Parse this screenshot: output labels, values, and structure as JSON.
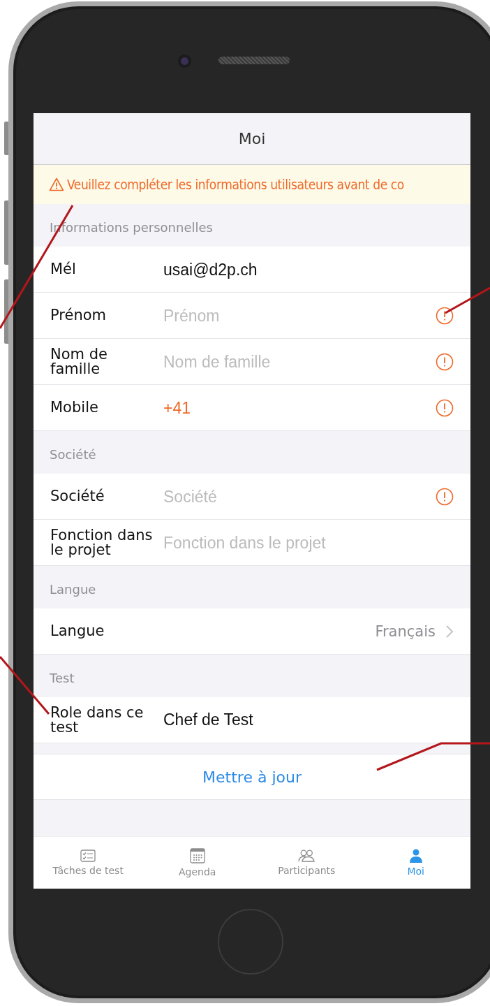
{
  "nav": {
    "title": "Moi"
  },
  "banner": {
    "text": "Veuillez compléter les informations utilisateurs avant de co"
  },
  "sections": [
    {
      "header": "Informations personnelles",
      "rows": [
        {
          "kind": "field",
          "label": "Mél",
          "value": "usai@d2p.ch",
          "warning": false
        },
        {
          "kind": "field",
          "label": "Prénom",
          "placeholder": "Prénom",
          "warning": true
        },
        {
          "kind": "field",
          "label": "Nom de famille",
          "placeholder": "Nom de famille",
          "warning": true
        },
        {
          "kind": "phone",
          "label": "Mobile",
          "value": "+41",
          "warning": true
        }
      ]
    },
    {
      "header": "Société",
      "rows": [
        {
          "kind": "field",
          "label": "Société",
          "placeholder": "Société",
          "warning": true
        },
        {
          "kind": "field",
          "label": "Fonction dans le projet",
          "placeholder": "Fonction dans le projet",
          "warning": false
        }
      ]
    },
    {
      "header": "Langue",
      "rows": [
        {
          "kind": "select",
          "label": "Langue",
          "value": "Français"
        }
      ]
    },
    {
      "header": "Test",
      "rows": [
        {
          "kind": "text",
          "label": "Role dans ce test",
          "value": "Chef de Test"
        }
      ]
    }
  ],
  "update_button": "Mettre à jour",
  "tabs": [
    {
      "label": "Tâches de test",
      "selected": false
    },
    {
      "label": "Agenda",
      "selected": false
    },
    {
      "label": "Participants",
      "selected": false
    },
    {
      "label": "Moi",
      "selected": true
    }
  ]
}
